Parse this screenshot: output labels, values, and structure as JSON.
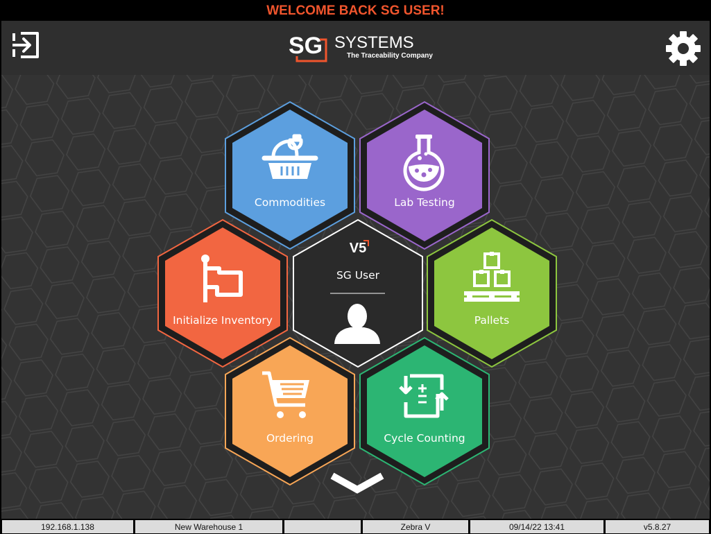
{
  "banner": {
    "text": "WELCOME BACK SG USER!"
  },
  "header": {
    "logo_sg": "SG",
    "logo_systems": "SYSTEMS",
    "logo_tagline": "The Traceability Company",
    "logout_icon": "logout-icon",
    "settings_icon": "gear-icon"
  },
  "tiles": {
    "commodities": {
      "label": "Commodities",
      "color": "#5c9fdf",
      "ring": "#5c9fdf",
      "icon": "basket-icon"
    },
    "lab_testing": {
      "label": "Lab Testing",
      "color": "#9a66cb",
      "ring": "#9a66cb",
      "icon": "flask-icon"
    },
    "initialize_inventory": {
      "label": "Initialize Inventory",
      "color": "#f26641",
      "ring": "#f26641",
      "icon": "flag-icon"
    },
    "pallets": {
      "label": "Pallets",
      "color": "#8dc63f",
      "ring": "#8dc63f",
      "icon": "pallet-icon"
    },
    "ordering": {
      "label": "Ordering",
      "color": "#f8a656",
      "ring": "#f8a656",
      "icon": "cart-icon"
    },
    "cycle_counting": {
      "label": "Cycle Counting",
      "color": "#2cb573",
      "ring": "#2cb573",
      "icon": "cycle-count-icon"
    },
    "center": {
      "version_mark": "V5",
      "user_name": "SG User",
      "icon": "user-avatar-icon"
    }
  },
  "more_icon": "chevron-down-icon",
  "footer": {
    "ip": "192.168.1.138",
    "location": "New Warehouse 1",
    "blank": "",
    "printer": "Zebra V",
    "datetime": "09/14/22 13:41",
    "version": "v5.8.27"
  },
  "colors": {
    "accent": "#f0552d",
    "background": "#333333",
    "header_bg": "#2f2f2f"
  }
}
